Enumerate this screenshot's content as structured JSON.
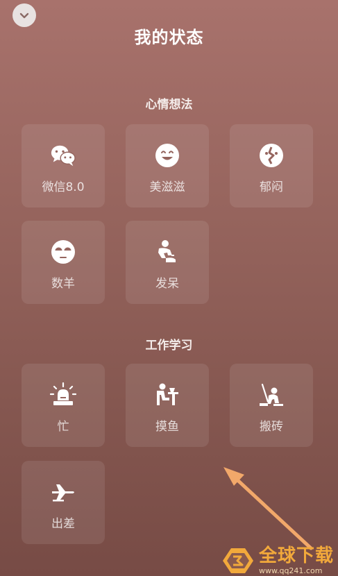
{
  "header": {
    "title": "我的状态"
  },
  "sections": [
    {
      "title": "心情想法",
      "items": [
        {
          "label": "微信8.0",
          "icon": "wechat-icon"
        },
        {
          "label": "美滋滋",
          "icon": "smile-icon"
        },
        {
          "label": "郁闷",
          "icon": "broken-heart-icon"
        },
        {
          "label": "数羊",
          "icon": "sleepy-face-icon"
        },
        {
          "label": "发呆",
          "icon": "daze-figure-icon"
        }
      ]
    },
    {
      "title": "工作学习",
      "items": [
        {
          "label": "忙",
          "icon": "alarm-light-icon"
        },
        {
          "label": "摸鱼",
          "icon": "desk-person-icon"
        },
        {
          "label": "搬砖",
          "icon": "worker-icon"
        },
        {
          "label": "出差",
          "icon": "airplane-icon"
        }
      ]
    }
  ],
  "watermark": {
    "name": "全球下载",
    "url": "www.qq241.com"
  },
  "colors": {
    "background_top": "#a8726c",
    "background_bottom": "#774b45",
    "arrow": "#f2a86a",
    "watermark": "#f2a93b"
  }
}
